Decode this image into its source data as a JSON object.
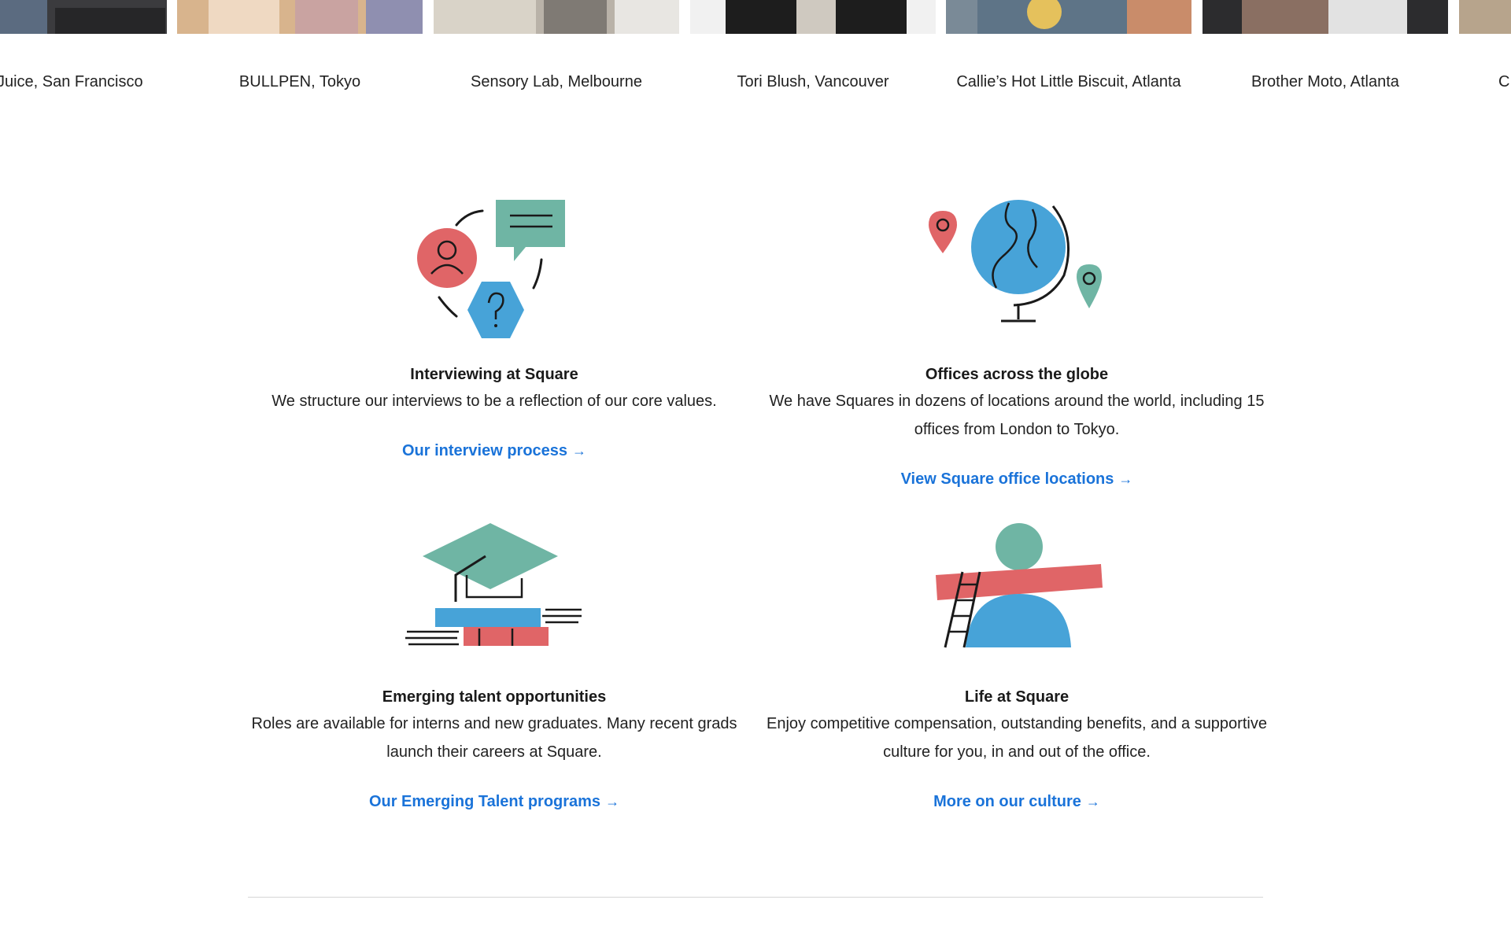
{
  "locations": [
    "Moose Juice, San Francisco",
    "BULLPEN, Tokyo",
    "Sensory Lab, Melbourne",
    "Tori Blush, Vancouver",
    "Callie’s Hot Little Biscuit, Atlanta",
    "Brother Moto, Atlanta",
    "C"
  ],
  "features": {
    "interviewing": {
      "title": "Interviewing at Square",
      "body": "We structure our interviews to be a reflection of our core values.",
      "link": "Our interview process"
    },
    "offices": {
      "title": "Offices across the globe",
      "body": "We have Squares in dozens of locations around the world, including 15 offices from London to Tokyo.",
      "link": "View Square office locations"
    },
    "emerging": {
      "title": "Emerging talent opportunities",
      "body": "Roles are available for interns and new graduates. Many recent grads launch their careers at Square.",
      "link": "Our Emerging Talent programs"
    },
    "life": {
      "title": "Life at Square",
      "body": "Enjoy competitive compensation, outstanding benefits, and a supportive culture for you, in and out of the office.",
      "link": "More on our culture"
    }
  },
  "link_arrow": "→",
  "colors": {
    "link": "#1a73d9",
    "teal": "#6fb5a4",
    "red": "#e06567",
    "blue": "#47a3d8"
  }
}
